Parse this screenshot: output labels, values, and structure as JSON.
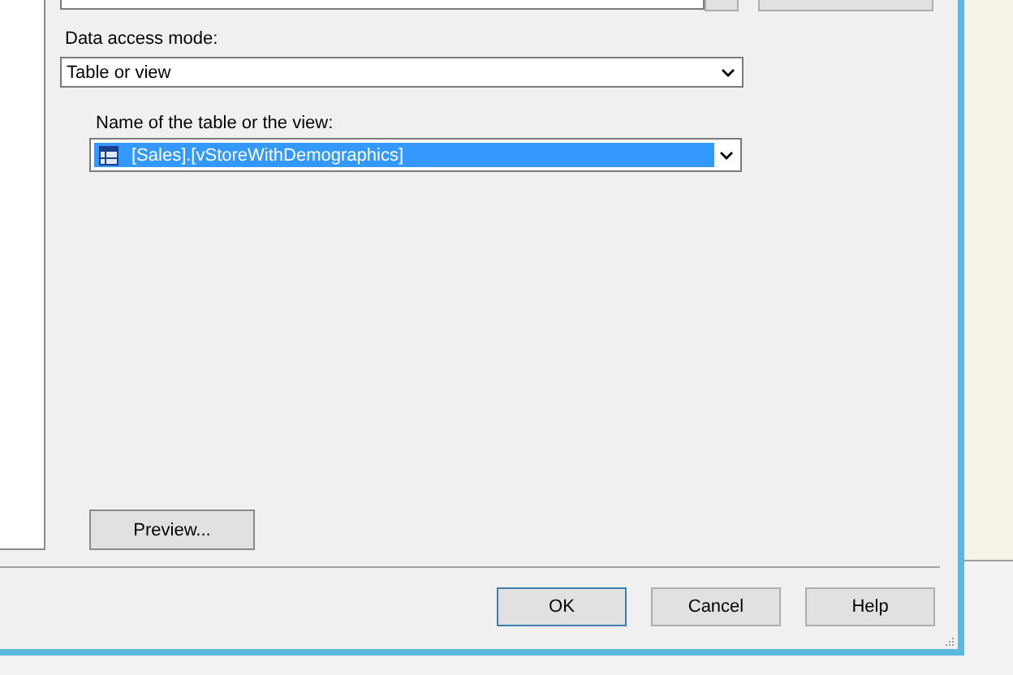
{
  "data_access_mode": {
    "label": "Data access mode:",
    "value": "Table or view"
  },
  "table_or_view": {
    "label": "Name of the table or the view:",
    "value": "[Sales].[vStoreWithDemographics]",
    "selected": true
  },
  "preview_button": "Preview...",
  "buttons": [
    {
      "label": "OK",
      "default": true
    },
    {
      "label": "Cancel",
      "default": false
    },
    {
      "label": "Help",
      "default": false
    }
  ]
}
